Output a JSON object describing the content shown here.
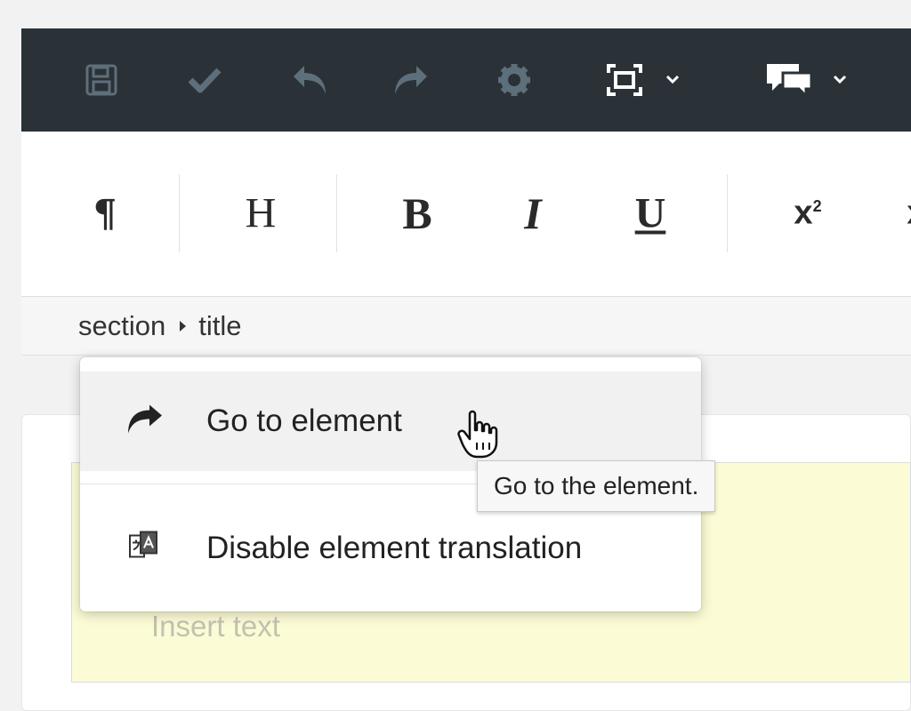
{
  "toolbar": {
    "buttons": [
      {
        "icon": "save-icon",
        "state": "disabled"
      },
      {
        "icon": "checkmark-icon",
        "state": "disabled"
      },
      {
        "icon": "undo-icon",
        "state": "disabled"
      },
      {
        "icon": "redo-icon",
        "state": "disabled"
      },
      {
        "icon": "gear-icon",
        "state": "disabled"
      },
      {
        "icon": "fullscreen-icon",
        "has_dropdown": true
      },
      {
        "icon": "comments-icon",
        "has_dropdown": true
      }
    ],
    "colors": {
      "background": "#2a3237",
      "icon_disabled": "#5d6f7a",
      "icon_active": "#ffffff"
    }
  },
  "format_toolbar": {
    "paragraph": "¶",
    "heading": "H",
    "bold": "B",
    "italic": "I",
    "underline": "U",
    "superscript_base": "x",
    "superscript_exp": "2",
    "edge_partial": "x"
  },
  "breadcrumb": {
    "items": [
      "section",
      "title"
    ]
  },
  "context_menu": {
    "items": [
      {
        "label": "Go to element",
        "icon": "goto-arrow-icon",
        "hovered": true
      },
      {
        "label": "Disable element translation",
        "icon": "translation-icon",
        "hovered": false
      }
    ]
  },
  "tooltip": {
    "text": "Go to the element."
  },
  "editor": {
    "title_placeholder": "Insert text",
    "title_background": "#fbfbd6"
  }
}
